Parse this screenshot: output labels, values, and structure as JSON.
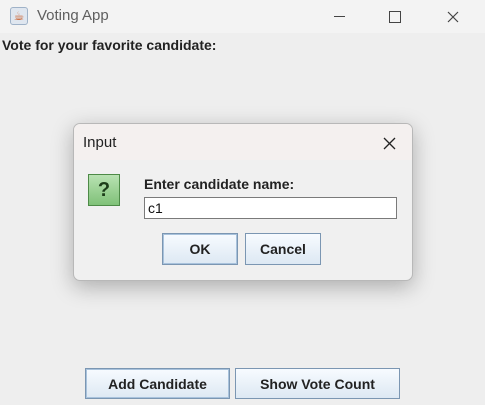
{
  "window": {
    "title": "Voting App",
    "heading": "Vote for your favorite candidate:"
  },
  "buttons": {
    "add_candidate": "Add Candidate",
    "show_vote_count": "Show Vote Count"
  },
  "dialog": {
    "title": "Input",
    "prompt": "Enter candidate name:",
    "input_value": "c1",
    "ok_label": "OK",
    "cancel_label": "Cancel",
    "icon": "question-icon"
  },
  "icons": {
    "app": "java-cup-icon",
    "minimize": "minimize-icon",
    "maximize": "maximize-icon",
    "close": "close-icon"
  }
}
